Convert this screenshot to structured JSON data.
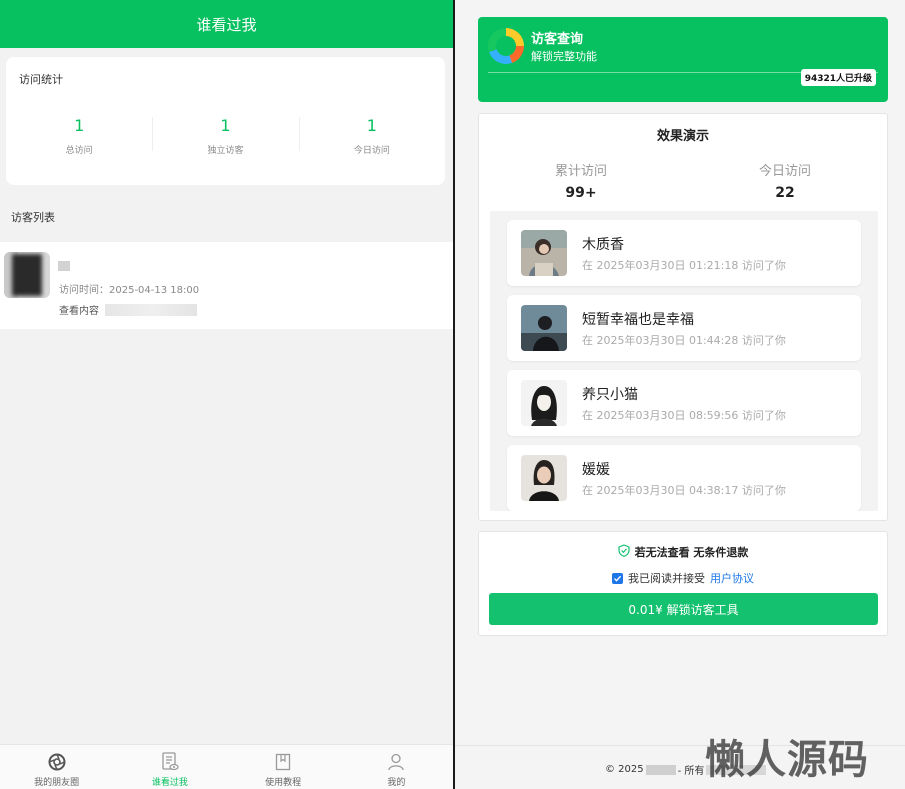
{
  "left": {
    "header_title": "谁看过我",
    "stats": {
      "title": "访问统计",
      "items": [
        {
          "value": "1",
          "label": "总访问"
        },
        {
          "value": "1",
          "label": "独立访客"
        },
        {
          "value": "1",
          "label": "今日访问"
        }
      ]
    },
    "visitor_list_title": "访客列表",
    "visitor": {
      "time": "访问时间：2025-04-13 18:00",
      "content_label": "查看内容"
    },
    "tabbar": [
      {
        "label": "我的朋友圈",
        "icon": "aperture-icon"
      },
      {
        "label": "谁看过我",
        "icon": "document-eye-icon"
      },
      {
        "label": "使用教程",
        "icon": "bookmark-icon"
      },
      {
        "label": "我的",
        "icon": "person-icon"
      }
    ]
  },
  "right": {
    "banner": {
      "title": "访客查询",
      "subtitle": "解锁完整功能",
      "badge": "94321人已升级"
    },
    "demo": {
      "title": "效果演示",
      "stats": [
        {
          "label": "累计访问",
          "value": "99+"
        },
        {
          "label": "今日访问",
          "value": "22"
        }
      ],
      "items": [
        {
          "name": "木质香",
          "desc": "在 2025年03月30日 01:21:18 访问了你"
        },
        {
          "name": "短暂幸福也是幸福",
          "desc": "在 2025年03月30日 01:44:28 访问了你"
        },
        {
          "name": "养只小猫",
          "desc": "在 2025年03月30日 08:59:56 访问了你"
        },
        {
          "name": "媛媛",
          "desc": "在 2025年03月30日 04:38:17 访问了你"
        }
      ]
    },
    "pay": {
      "refund_text": "若无法查看 无条件退款",
      "agree_text": "我已阅读并接受",
      "agree_link": "用户协议",
      "button": "0.01¥ 解锁访客工具"
    },
    "footer": {
      "prefix": "© 2025",
      "middle": "- 所有"
    },
    "watermark": "懒人源码"
  },
  "colors": {
    "primary_green": "#07c160",
    "link_blue": "#1e77e8"
  }
}
